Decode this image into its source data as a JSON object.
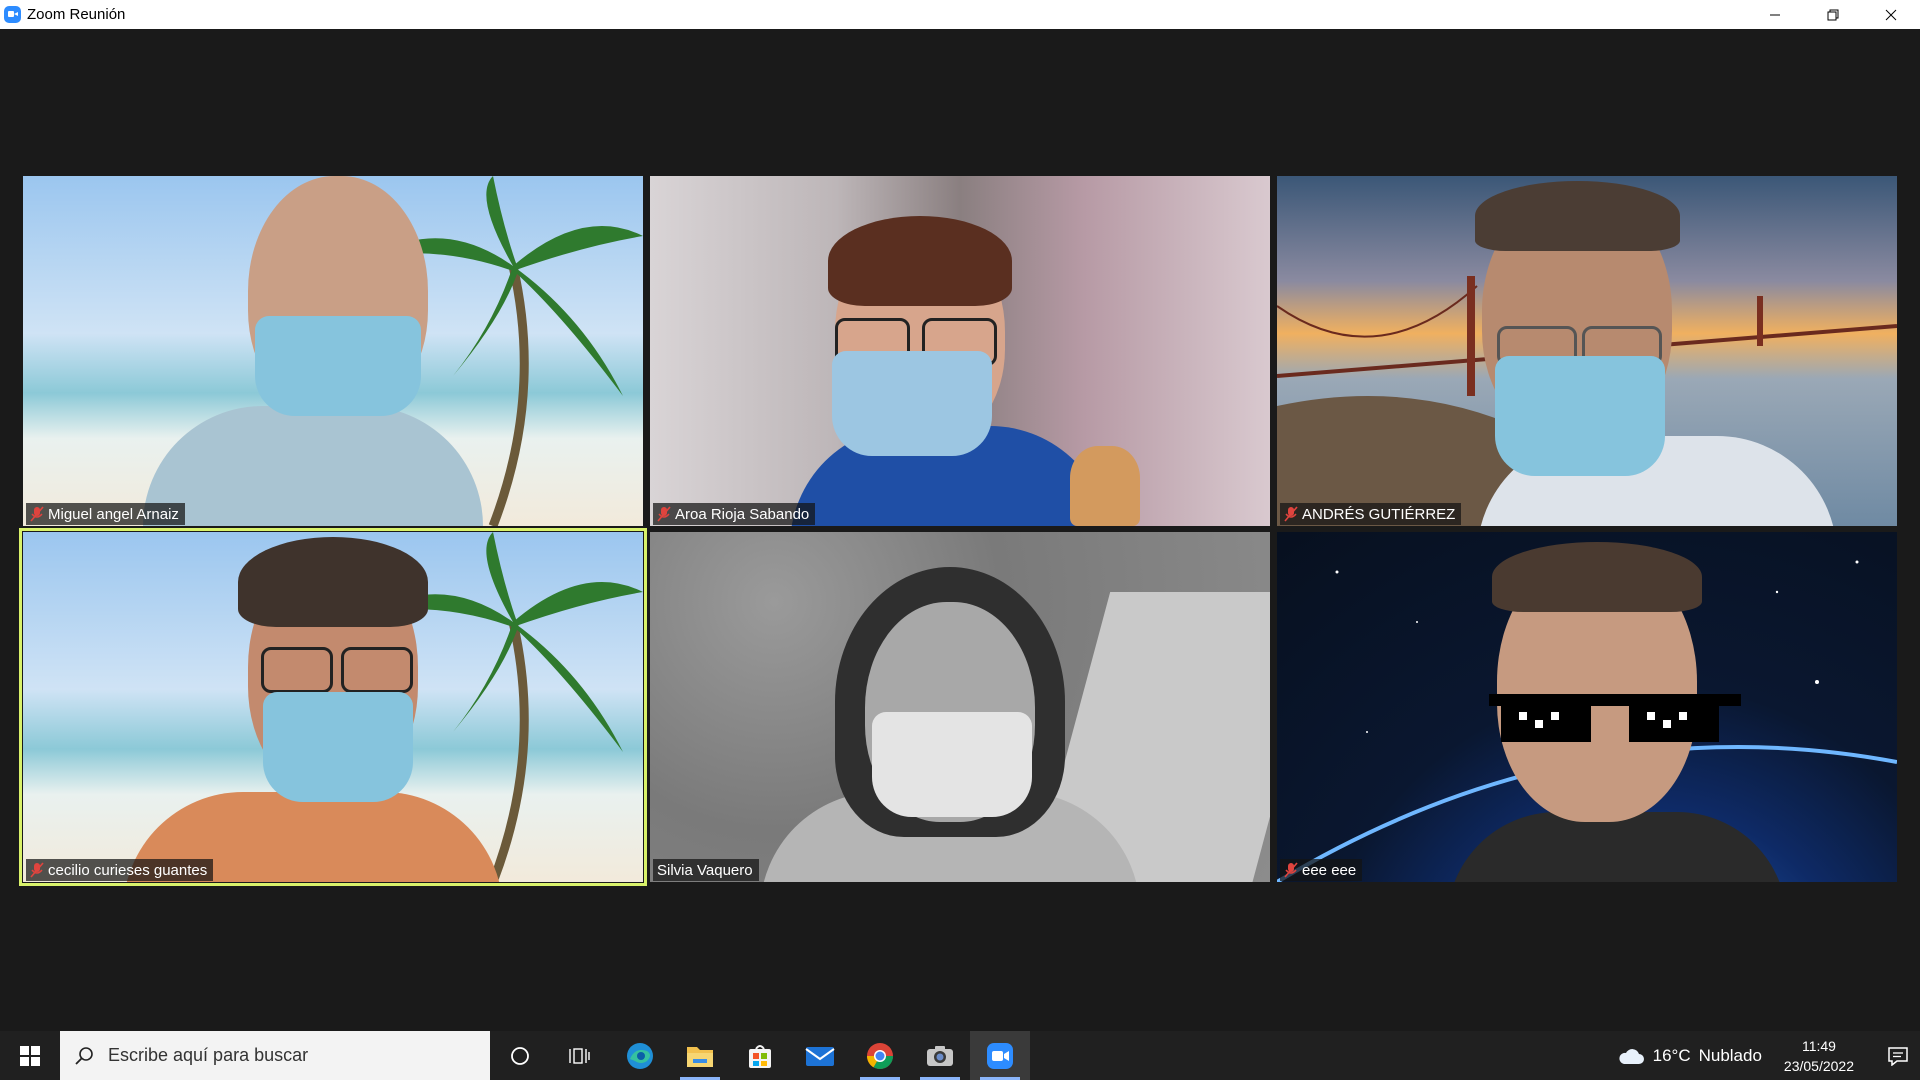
{
  "window": {
    "title": "Zoom Reunión"
  },
  "participants": [
    {
      "name": "Miguel angel Arnaiz",
      "muted": true,
      "background": "beach"
    },
    {
      "name": "Aroa Rioja Sabando",
      "muted": true,
      "background": "blur"
    },
    {
      "name": "ANDRÉS GUTIÉRREZ",
      "muted": true,
      "background": "bridge"
    },
    {
      "name": "cecilio curieses guantes",
      "muted": true,
      "background": "beach",
      "active_speaker": true
    },
    {
      "name": "Silvia Vaquero",
      "muted": false,
      "background": "grayscale"
    },
    {
      "name": "eee eee",
      "muted": true,
      "background": "space"
    }
  ],
  "taskbar": {
    "search_placeholder": "Escribe aquí para buscar",
    "apps": [
      "cortana-icon",
      "task-view-icon",
      "edge-icon",
      "file-explorer-icon",
      "store-icon",
      "mail-icon",
      "chrome-icon",
      "camera-icon",
      "zoom-icon"
    ],
    "weather": {
      "temp": "16°C",
      "condition": "Nublado"
    },
    "time": "11:49",
    "date": "23/05/2022"
  },
  "colors": {
    "active_speaker_border": "#d9f26a",
    "zoom_blue": "#2d8cff",
    "muted_red": "#e0443e"
  }
}
